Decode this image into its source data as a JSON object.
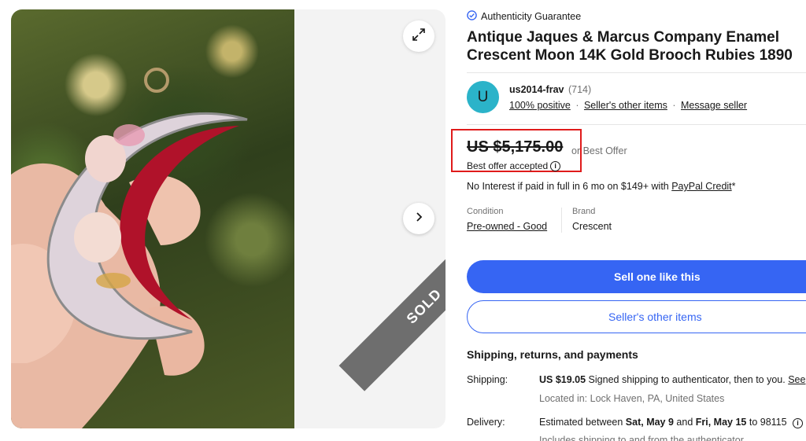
{
  "gallery": {
    "sold_badge": "SOLD",
    "expand_icon": "expand-icon",
    "next_icon": "chevron-right-icon"
  },
  "listing": {
    "authenticity": "Authenticity Guarantee",
    "title": "Antique Jaques & Marcus Company Enamel Crescent Moon 14K Gold Brooch Rubies 1890"
  },
  "seller": {
    "avatar_letter": "U",
    "name": "us2014-frav",
    "feedback_count": "(714)",
    "positive": "100% positive",
    "other_items": "Seller's other items",
    "message": "Message seller"
  },
  "price": {
    "amount": "US $5,175.00",
    "best_offer": "or Best Offer",
    "offer_accepted": "Best offer accepted"
  },
  "financing": {
    "text": "No Interest if paid in full in 6 mo on $149+ with ",
    "link": "PayPal Credit",
    "suffix": "*"
  },
  "condition": {
    "label": "Condition",
    "value": "Pre-owned - Good"
  },
  "brand": {
    "label": "Brand",
    "value": "Crescent"
  },
  "buttons": {
    "sell_one": "Sell one like this",
    "other_items": "Seller's other items"
  },
  "shipping": {
    "heading": "Shipping, returns, and payments",
    "shipping_label": "Shipping:",
    "shipping_price": "US $19.05",
    "shipping_desc": " Signed shipping to authenticator, then to you. ",
    "shipping_link": "See",
    "location": "Located in: Lock Haven, PA, United States",
    "delivery_label": "Delivery:",
    "delivery_prefix": "Estimated between ",
    "delivery_start": "Sat, May 9",
    "delivery_and": " and ",
    "delivery_end": "Fri, May 15",
    "delivery_to": " to 98115",
    "delivery_note": "Includes shipping to and from the authenticator"
  },
  "colors": {
    "accent": "#3665f3",
    "highlight_box": "#e01b1b",
    "avatar": "#2bb3c9"
  }
}
